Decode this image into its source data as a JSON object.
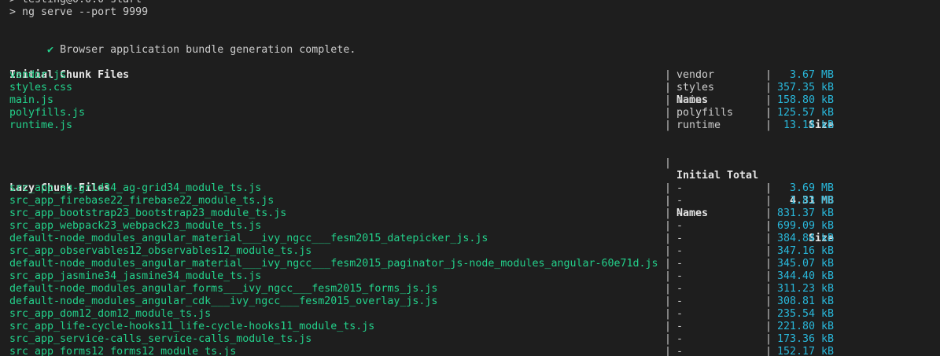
{
  "prompt_lines": [
    "> testing@0.0.0 start",
    "> ng serve --port 9999"
  ],
  "check_glyph": "✔",
  "status_message": "Browser application bundle generation complete.",
  "initial": {
    "header": {
      "files": "Initial Chunk Files",
      "names": "Names",
      "size": "Size"
    },
    "rows": [
      {
        "file": "vendor.js",
        "name": "vendor",
        "size": "3.67 MB"
      },
      {
        "file": "styles.css",
        "name": "styles",
        "size": "357.35 kB"
      },
      {
        "file": "main.js",
        "name": "main",
        "size": "158.80 kB"
      },
      {
        "file": "polyfills.js",
        "name": "polyfills",
        "size": "125.57 kB"
      },
      {
        "file": "runtime.js",
        "name": "runtime",
        "size": "13.14 kB"
      }
    ],
    "total_label": "Initial Total",
    "total_size": "4.31 MB"
  },
  "lazy": {
    "header": {
      "files": "Lazy Chunk Files",
      "names": "Names",
      "size": "Size"
    },
    "rows": [
      {
        "file": "src_app_ag-grid34_ag-grid34_module_ts.js",
        "name": "-",
        "size": "3.69 MB"
      },
      {
        "file": "src_app_firebase22_firebase22_module_ts.js",
        "name": "-",
        "size": "1.83 MB"
      },
      {
        "file": "src_app_bootstrap23_bootstrap23_module_ts.js",
        "name": "-",
        "size": "831.37 kB"
      },
      {
        "file": "src_app_webpack23_webpack23_module_ts.js",
        "name": "-",
        "size": "699.09 kB"
      },
      {
        "file": "default-node_modules_angular_material___ivy_ngcc___fesm2015_datepicker_js.js",
        "name": "-",
        "size": "384.84 kB"
      },
      {
        "file": "src_app_observables12_observables12_module_ts.js",
        "name": "-",
        "size": "347.16 kB"
      },
      {
        "file": "default-node_modules_angular_material___ivy_ngcc___fesm2015_paginator_js-node_modules_angular-60e71d.js",
        "name": "-",
        "size": "345.07 kB"
      },
      {
        "file": "src_app_jasmine34_jasmine34_module_ts.js",
        "name": "-",
        "size": "344.40 kB"
      },
      {
        "file": "default-node_modules_angular_forms___ivy_ngcc___fesm2015_forms_js.js",
        "name": "-",
        "size": "311.23 kB"
      },
      {
        "file": "default-node_modules_angular_cdk___ivy_ngcc___fesm2015_overlay_js.js",
        "name": "-",
        "size": "308.81 kB"
      },
      {
        "file": "src_app_dom12_dom12_module_ts.js",
        "name": "-",
        "size": "235.54 kB"
      },
      {
        "file": "src_app_life-cycle-hooks11_life-cycle-hooks11_module_ts.js",
        "name": "-",
        "size": "221.80 kB"
      },
      {
        "file": "src_app_service-calls_service-calls_module_ts.js",
        "name": "-",
        "size": "173.36 kB"
      },
      {
        "file": "src_app_forms12_forms12_module_ts.js",
        "name": "-",
        "size": "152.17 kB"
      }
    ]
  },
  "pipe_glyph": "|",
  "colors": {
    "background": "#1e1e1e",
    "file_name": "#23d18b",
    "size": "#29b8db",
    "text": "#cccccc"
  }
}
